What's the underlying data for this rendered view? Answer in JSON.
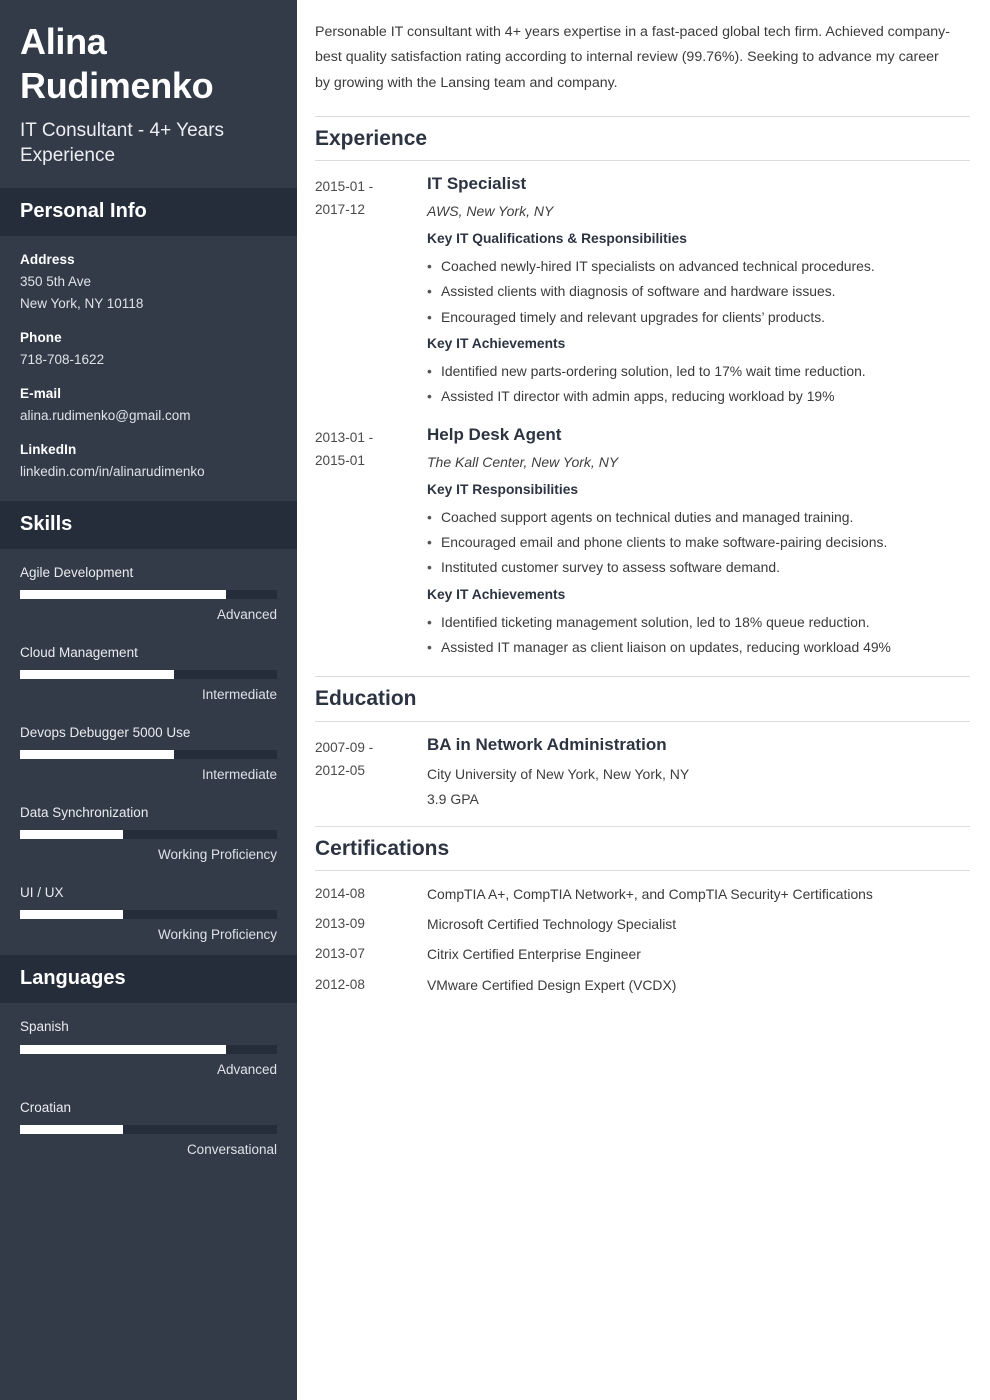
{
  "colors": {
    "sidebar_bg": "#333b49",
    "sidebar_band_bg": "#262d3a",
    "bar_fill": "#ffffff",
    "bar_track": "#262d3a",
    "heading": "#2c3442",
    "body_text": "#3b3b3b",
    "rule": "#dcdcdc"
  },
  "sidebar": {
    "full_name": "Alina Rudimenko",
    "job_title": "IT Consultant - 4+ Years Experience",
    "personal_info": {
      "heading": "Personal Info",
      "groups": [
        {
          "label": "Address",
          "lines": [
            "350 5th Ave",
            "New York, NY 10118"
          ]
        },
        {
          "label": "Phone",
          "lines": [
            "718-708-1622"
          ]
        },
        {
          "label": "E-mail",
          "lines": [
            "alina.rudimenko@gmail.com"
          ]
        },
        {
          "label": "LinkedIn",
          "lines": [
            "linkedin.com/in/alinarudimenko"
          ]
        }
      ]
    },
    "skills": {
      "heading": "Skills",
      "items": [
        {
          "name": "Agile Development",
          "level": "Advanced",
          "percent": 80
        },
        {
          "name": "Cloud Management",
          "level": "Intermediate",
          "percent": 60
        },
        {
          "name": "Devops Debugger 5000 Use",
          "level": "Intermediate",
          "percent": 60
        },
        {
          "name": "Data Synchronization",
          "level": "Working Proficiency",
          "percent": 40
        },
        {
          "name": "UI / UX",
          "level": "Working Proficiency",
          "percent": 40
        }
      ]
    },
    "languages": {
      "heading": "Languages",
      "items": [
        {
          "name": "Spanish",
          "level": "Advanced",
          "percent": 80
        },
        {
          "name": "Croatian",
          "level": "Conversational",
          "percent": 40
        }
      ]
    }
  },
  "main": {
    "summary": "Personable IT consultant with 4+ years expertise in a fast-paced global tech firm. Achieved company-best quality satisfaction rating according to internal review (99.76%). Seeking to advance my career by growing with the Lansing team and company.",
    "experience": {
      "heading": "Experience",
      "entries": [
        {
          "dates": "2015-01 - 2017-12",
          "date_start": "2015-01 -",
          "date_end": "2017-12",
          "role": "IT Specialist",
          "org": "AWS, New York, NY",
          "blocks": [
            {
              "sub_head": "Key IT Qualifications & Responsibilities",
              "bullets": [
                "Coached newly-hired IT specialists on advanced technical procedures.",
                "Assisted clients with diagnosis of software and hardware issues.",
                "Encouraged timely and relevant upgrades for clients’ products."
              ]
            },
            {
              "sub_head": "Key IT Achievements",
              "bullets": [
                "Identified new parts-ordering solution, led to 17% wait time reduction.",
                "Assisted IT director with admin apps, reducing workload by 19%"
              ]
            }
          ]
        },
        {
          "dates": "2013-01 - 2015-01",
          "date_start": "2013-01 -",
          "date_end": "2015-01",
          "role": "Help Desk Agent",
          "org": "The Kall Center, New York, NY",
          "blocks": [
            {
              "sub_head": "Key IT Responsibilities",
              "bullets": [
                "Coached support agents on technical duties and managed training.",
                "Encouraged email and phone clients to make software-pairing decisions.",
                "Instituted customer survey to assess software demand."
              ]
            },
            {
              "sub_head": "Key IT Achievements",
              "bullets": [
                "Identified ticketing management solution, led to 18% queue reduction.",
                "Assisted IT manager as client liaison on updates, reducing workload 49%"
              ]
            }
          ]
        }
      ]
    },
    "education": {
      "heading": "Education",
      "entries": [
        {
          "date_start": "2007-09 -",
          "date_end": "2012-05",
          "degree": "BA in Network Administration",
          "school": "City University of New York, New York, NY",
          "gpa": "3.9 GPA"
        }
      ]
    },
    "certifications": {
      "heading": "Certifications",
      "rows": [
        {
          "date": "2014-08",
          "text": "CompTIA A+, CompTIA Network+, and CompTIA Security+ Certifications"
        },
        {
          "date": "2013-09",
          "text": "Microsoft Certified Technology Specialist"
        },
        {
          "date": "2013-07",
          "text": "Citrix Certified Enterprise Engineer"
        },
        {
          "date": "2012-08",
          "text": "VMware Certified Design Expert (VCDX)"
        }
      ]
    }
  }
}
